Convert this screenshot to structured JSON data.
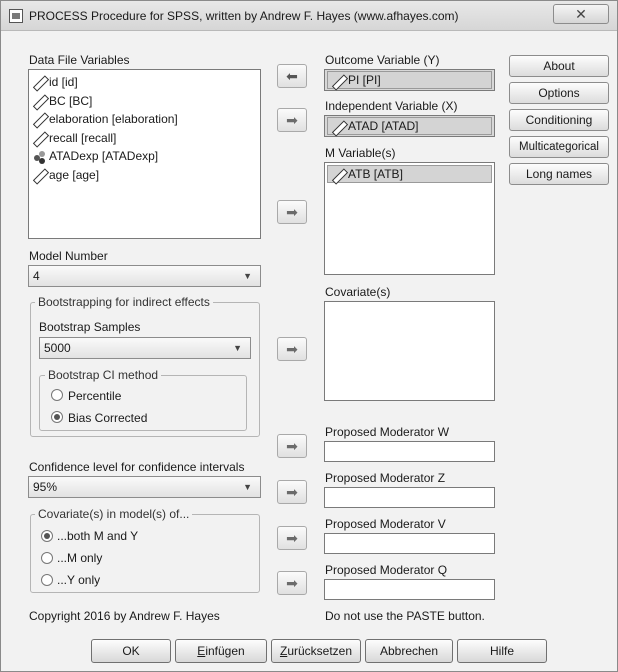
{
  "window": {
    "title": "PROCESS Procedure for SPSS, written by Andrew F. Hayes (www.afhayes.com)",
    "close_glyph": "✕"
  },
  "data_file": {
    "label": "Data File Variables",
    "items": [
      {
        "label": "id [id]",
        "icon": "scale-icon"
      },
      {
        "label": "BC [BC]",
        "icon": "scale-icon"
      },
      {
        "label": "elaboration [elaboration]",
        "icon": "scale-icon"
      },
      {
        "label": "recall [recall]",
        "icon": "scale-icon"
      },
      {
        "label": "ATADexp [ATADexp]",
        "icon": "nominal-icon"
      },
      {
        "label": "age [age]",
        "icon": "scale-icon"
      }
    ]
  },
  "outcome": {
    "label": "Outcome Variable (Y)",
    "value": "PI [PI]"
  },
  "independent": {
    "label": "Independent Variable (X)",
    "value": "ATAD [ATAD]"
  },
  "mediator": {
    "label": "M Variable(s)",
    "items": [
      "ATB [ATB]"
    ]
  },
  "covariates": {
    "label": "Covariate(s)"
  },
  "moderators": {
    "w": "Proposed Moderator W",
    "z": "Proposed Moderator Z",
    "v": "Proposed Moderator V",
    "q": "Proposed Moderator Q"
  },
  "side_buttons": [
    "About",
    "Options",
    "Conditioning",
    "Multicategorical",
    "Long names"
  ],
  "model": {
    "label": "Model Number",
    "value": "4"
  },
  "bootstrap": {
    "group_label": "Bootstrapping for indirect effects",
    "samples_label": "Bootstrap Samples",
    "samples_value": "5000",
    "ci_group_label": "Bootstrap CI method",
    "options": [
      {
        "label": "Percentile",
        "checked": false
      },
      {
        "label": "Bias Corrected",
        "checked": true
      }
    ]
  },
  "confidence": {
    "label": "Confidence level for confidence intervals",
    "value": "95%"
  },
  "covariates_in": {
    "group_label": "Covariate(s) in model(s) of...",
    "options": [
      {
        "label": "...both M and Y",
        "checked": true
      },
      {
        "label": "...M only",
        "checked": false
      },
      {
        "label": "...Y only",
        "checked": false
      }
    ]
  },
  "footer": {
    "copyright": "Copyright 2016 by Andrew F. Hayes",
    "paste_note": "Do not use the PASTE button."
  },
  "buttons": {
    "ok": "OK",
    "paste_first": "E",
    "paste_rest": "infügen",
    "reset_first": "Z",
    "reset_rest": "urücksetzen",
    "cancel": "Abbrechen",
    "help": "Hilfe"
  }
}
